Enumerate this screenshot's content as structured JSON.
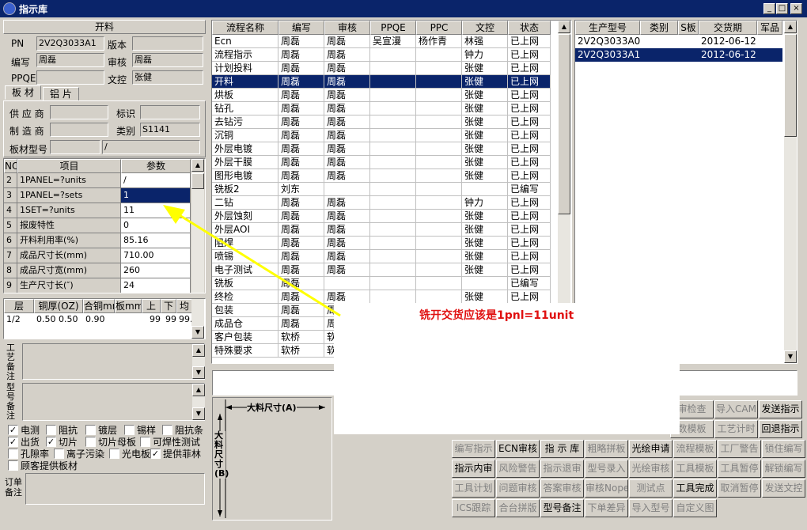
{
  "window": {
    "title": "指示库"
  },
  "left": {
    "header": "开料",
    "pn_label": "PN",
    "pn": "2V2Q3033A1",
    "version_label": "版本",
    "version": "",
    "editor_label": "编写",
    "editor": "周磊",
    "reviewer_label": "审核",
    "reviewer": "周磊",
    "ppqe_label": "PPQE",
    "ppqe": "",
    "doc_label": "文控",
    "doc": "张健",
    "tab_board": "板 材",
    "tab_foil": "铝 片",
    "supplier_label": "供 应 商",
    "supplier": "",
    "mark_label": "标识",
    "mark": "",
    "maker_label": "制 造 商",
    "maker": "",
    "category_label": "类别",
    "category": "S1141",
    "model_label": "板材型号",
    "model_a": "",
    "model_b": "/"
  },
  "params": {
    "headers": [
      "NO",
      "项目",
      "参数"
    ],
    "rows": [
      [
        "2",
        "1PANEL=?units",
        "/"
      ],
      [
        "3",
        "1PANEL=?sets",
        "1"
      ],
      [
        "4",
        "1SET=?units",
        "11"
      ],
      [
        "5",
        "报废特性",
        "0"
      ],
      [
        "6",
        "开料利用率(%)",
        "85.16"
      ],
      [
        "7",
        "成品尺寸长(mm)",
        "710.00"
      ],
      [
        "8",
        "成品尺寸宽(mm)",
        "260"
      ],
      [
        "9",
        "生产尺寸长(″)",
        "24"
      ]
    ]
  },
  "layers": {
    "headers": [
      "层",
      "铜厚(OZ)",
      "合铜mm",
      "板mm",
      "上",
      "下",
      "均"
    ],
    "rows": [
      [
        "1/2",
        "0.50 0.50",
        "0.90",
        "",
        "99",
        "99",
        "99."
      ]
    ]
  },
  "notes": {
    "craft_label": "工艺备注",
    "type_label": "型号备注",
    "order_label": "订单备注"
  },
  "checkboxes": [
    {
      "label": "电测",
      "checked": true
    },
    {
      "label": "阻抗",
      "checked": false
    },
    {
      "label": "镀层",
      "checked": false
    },
    {
      "label": "锡样",
      "checked": false
    },
    {
      "label": "阻抗条",
      "checked": false
    },
    {
      "label": "出货",
      "checked": true
    },
    {
      "label": "切片",
      "checked": true
    },
    {
      "label": "切片母板",
      "checked": false
    },
    {
      "label": "可焊性测试",
      "checked": false
    },
    {
      "label": "孔隙率",
      "checked": false
    },
    {
      "label": "离子污染",
      "checked": false
    },
    {
      "label": "光电板",
      "checked": false
    },
    {
      "label": "提供菲林",
      "checked": true
    },
    {
      "label": "顾客提供板材",
      "checked": false
    }
  ],
  "process": {
    "headers": [
      "流程名称",
      "编写",
      "审核",
      "PPQE",
      "PPC",
      "文控",
      "状态"
    ],
    "rows": [
      [
        "Ecn",
        "周磊",
        "周磊",
        "吴宣漫",
        "杨作青",
        "林强",
        "已上网"
      ],
      [
        "流程指示",
        "周磊",
        "周磊",
        "",
        "",
        "钟力",
        "已上网"
      ],
      [
        "计划投料",
        "周磊",
        "周磊",
        "",
        "",
        "张健",
        "已上网"
      ],
      [
        "开料",
        "周磊",
        "周磊",
        "",
        "",
        "张健",
        "已上网"
      ],
      [
        "烘板",
        "周磊",
        "周磊",
        "",
        "",
        "张健",
        "已上网"
      ],
      [
        "钻孔",
        "周磊",
        "周磊",
        "",
        "",
        "张健",
        "已上网"
      ],
      [
        "去钻污",
        "周磊",
        "周磊",
        "",
        "",
        "张健",
        "已上网"
      ],
      [
        "沉铜",
        "周磊",
        "周磊",
        "",
        "",
        "张健",
        "已上网"
      ],
      [
        "外层电镀",
        "周磊",
        "周磊",
        "",
        "",
        "张健",
        "已上网"
      ],
      [
        "外层干膜",
        "周磊",
        "周磊",
        "",
        "",
        "张健",
        "已上网"
      ],
      [
        "图形电镀",
        "周磊",
        "周磊",
        "",
        "",
        "张健",
        "已上网"
      ],
      [
        "铣板2",
        "刘东",
        "",
        "",
        "",
        "",
        "已编写"
      ],
      [
        "二钻",
        "周磊",
        "周磊",
        "",
        "",
        "钟力",
        "已上网"
      ],
      [
        "外层蚀刻",
        "周磊",
        "周磊",
        "",
        "",
        "张健",
        "已上网"
      ],
      [
        "外层AOI",
        "周磊",
        "周磊",
        "",
        "",
        "张健",
        "已上网"
      ],
      [
        "阻焊",
        "周磊",
        "周磊",
        "",
        "",
        "张健",
        "已上网"
      ],
      [
        "喷锡",
        "周磊",
        "周磊",
        "",
        "",
        "张健",
        "已上网"
      ],
      [
        "电子测试",
        "周磊",
        "周磊",
        "",
        "",
        "张健",
        "已上网"
      ],
      [
        "铣板",
        "周磊",
        "",
        "",
        "",
        "",
        "已编写"
      ],
      [
        "终检",
        "周磊",
        "周磊",
        "",
        "",
        "张健",
        "已上网"
      ],
      [
        "包装",
        "周磊",
        "周",
        "",
        "",
        "",
        ""
      ],
      [
        "成品仓",
        "周磊",
        "周",
        "",
        "",
        "",
        ""
      ],
      [
        "客户包装",
        "软桥",
        "软",
        "",
        "",
        "",
        ""
      ],
      [
        "特殊要求",
        "软桥",
        "软",
        "",
        "",
        "",
        ""
      ]
    ],
    "selected": 3
  },
  "models": {
    "headers": [
      "生产型号",
      "类别",
      "S板",
      "交货期",
      "军品"
    ],
    "rows": [
      [
        "2V2Q3033A0",
        "",
        "",
        "2012-06-12",
        ""
      ],
      [
        "2V2Q3033A1",
        "",
        "",
        "2012-06-12",
        ""
      ]
    ],
    "selected": 1
  },
  "annotation": {
    "text": "铣开交货应该是1pnl=11unit"
  },
  "diagram": {
    "size_a": "大料尺寸(A)",
    "size_b": "大料尺寸(B)"
  },
  "buttons": [
    [
      "审检查",
      "导入CAM",
      "发送指示"
    ],
    [
      "数模板",
      "工艺计时",
      "回退指示"
    ],
    [
      "编写指示",
      "ECN审核",
      "指 示 库",
      "粗略拼板",
      "光绘申请",
      "流程模板",
      "工厂警告",
      "锁住编写"
    ],
    [
      "指示内审",
      "风险警告",
      "指示退审",
      "型号录入",
      "光绘审核",
      "工具模板",
      "工具暂停",
      "解锁编写"
    ],
    [
      "工具计划",
      "问题审核",
      "答案审核",
      "审核Nope",
      "测试点",
      "工具完成",
      "取消暂停",
      "发送文控"
    ],
    [
      "ICS跟踪",
      "合台拼版",
      "型号备注",
      "下单差异",
      "导入型号",
      "自定义图"
    ]
  ]
}
